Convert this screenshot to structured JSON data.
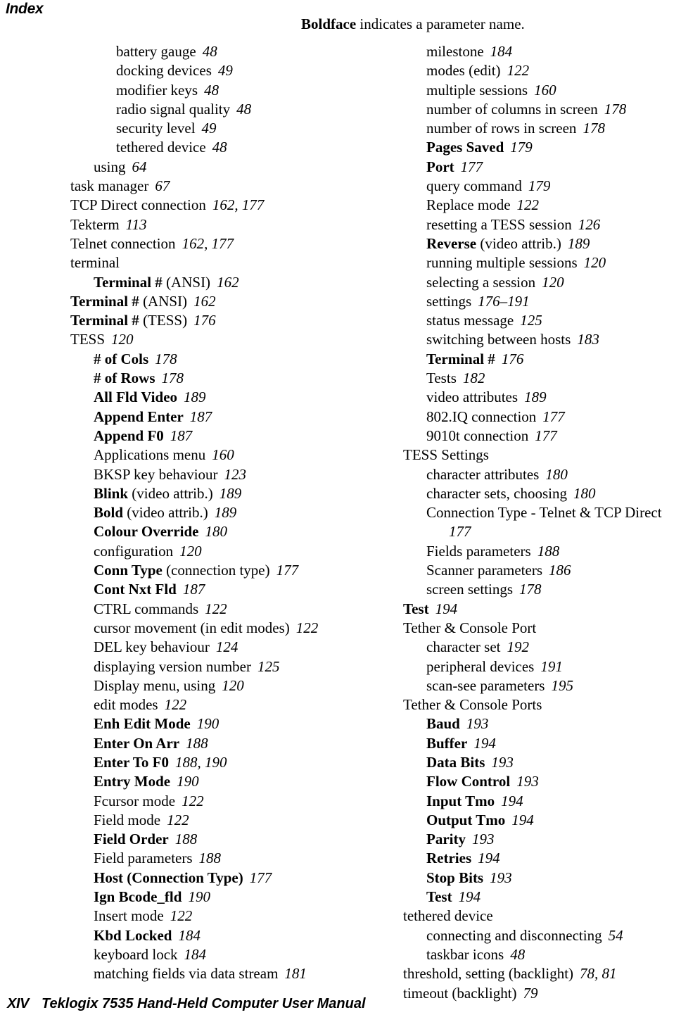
{
  "header": {
    "title": "Index",
    "note_bold": "Boldface",
    "note_rest": " indicates a parameter name."
  },
  "footer": {
    "folio": "XIV",
    "title": "Teklogix 7535 Hand-Held Computer User Manual"
  },
  "columns": {
    "left": [
      {
        "level": 2,
        "text": "battery gauge",
        "bold": false,
        "pages": "48"
      },
      {
        "level": 2,
        "text": "docking devices",
        "bold": false,
        "pages": "49"
      },
      {
        "level": 2,
        "text": "modifier keys",
        "bold": false,
        "pages": "48"
      },
      {
        "level": 2,
        "text": "radio signal quality",
        "bold": false,
        "pages": "48"
      },
      {
        "level": 2,
        "text": "security level",
        "bold": false,
        "pages": "49"
      },
      {
        "level": 2,
        "text": "tethered device",
        "bold": false,
        "pages": "48"
      },
      {
        "level": 1,
        "text": "using",
        "bold": false,
        "pages": "64"
      },
      {
        "level": 0,
        "text": "task manager",
        "bold": false,
        "pages": "67"
      },
      {
        "level": 0,
        "text": "TCP Direct connection",
        "bold": false,
        "pages": "162, 177"
      },
      {
        "level": 0,
        "text": "Tekterm",
        "bold": false,
        "pages": "113"
      },
      {
        "level": 0,
        "text": "Telnet connection",
        "bold": false,
        "pages": "162, 177"
      },
      {
        "level": 0,
        "text": "terminal",
        "bold": false,
        "pages": ""
      },
      {
        "level": 1,
        "text": "Terminal #",
        "bold": true,
        "suffix": " (ANSI)",
        "pages": "162"
      },
      {
        "level": 0,
        "text": "Terminal #",
        "bold": true,
        "suffix": " (ANSI)",
        "pages": "162"
      },
      {
        "level": 0,
        "text": "Terminal #",
        "bold": true,
        "suffix": " (TESS)",
        "pages": "176"
      },
      {
        "level": 0,
        "text": "TESS",
        "bold": false,
        "pages": "120"
      },
      {
        "level": 1,
        "text": "# of Cols",
        "bold": true,
        "pages": "178"
      },
      {
        "level": 1,
        "text": "# of Rows",
        "bold": true,
        "pages": "178"
      },
      {
        "level": 1,
        "text": "All Fld Video",
        "bold": true,
        "pages": "189"
      },
      {
        "level": 1,
        "text": "Append Enter",
        "bold": true,
        "pages": "187"
      },
      {
        "level": 1,
        "text": "Append F0",
        "bold": true,
        "pages": "187"
      },
      {
        "level": 1,
        "text": "Applications menu",
        "bold": false,
        "pages": "160"
      },
      {
        "level": 1,
        "text": "BKSP key behaviour",
        "bold": false,
        "pages": "123"
      },
      {
        "level": 1,
        "text": "Blink",
        "bold": true,
        "suffix": " (video attrib.)",
        "pages": "189"
      },
      {
        "level": 1,
        "text": "Bold",
        "bold": true,
        "suffix": " (video attrib.)",
        "pages": "189"
      },
      {
        "level": 1,
        "text": "Colour Override",
        "bold": true,
        "pages": "180"
      },
      {
        "level": 1,
        "text": "configuration",
        "bold": false,
        "pages": "120"
      },
      {
        "level": 1,
        "text": "Conn Type",
        "bold": true,
        "suffix": " (connection type)",
        "pages": "177"
      },
      {
        "level": 1,
        "text": "Cont Nxt Fld",
        "bold": true,
        "pages": "187"
      },
      {
        "level": 1,
        "text": "CTRL commands",
        "bold": false,
        "pages": "122"
      },
      {
        "level": 1,
        "text": "cursor movement (in edit modes)",
        "bold": false,
        "pages": "122"
      },
      {
        "level": 1,
        "text": "DEL key behaviour",
        "bold": false,
        "pages": "124"
      },
      {
        "level": 1,
        "text": "displaying version number",
        "bold": false,
        "pages": "125"
      },
      {
        "level": 1,
        "text": "Display menu, using",
        "bold": false,
        "pages": "120"
      },
      {
        "level": 1,
        "text": "edit modes",
        "bold": false,
        "pages": "122"
      },
      {
        "level": 1,
        "text": "Enh Edit Mode",
        "bold": true,
        "pages": "190"
      },
      {
        "level": 1,
        "text": "Enter On Arr",
        "bold": true,
        "pages": "188"
      },
      {
        "level": 1,
        "text": "Enter To F0",
        "bold": true,
        "pages": "188, 190"
      },
      {
        "level": 1,
        "text": "Entry Mode",
        "bold": true,
        "pages": "190"
      },
      {
        "level": 1,
        "text": "Fcursor mode",
        "bold": false,
        "pages": "122"
      },
      {
        "level": 1,
        "text": "Field mode",
        "bold": false,
        "pages": "122"
      },
      {
        "level": 1,
        "text": "Field Order",
        "bold": true,
        "pages": "188"
      },
      {
        "level": 1,
        "text": "Field parameters",
        "bold": false,
        "pages": "188"
      },
      {
        "level": 1,
        "text": "Host (Connection Type)",
        "bold": true,
        "pages": "177"
      },
      {
        "level": 1,
        "text": "Ign Bcode_fld",
        "bold": true,
        "pages": "190"
      },
      {
        "level": 1,
        "text": "Insert mode",
        "bold": false,
        "pages": "122"
      },
      {
        "level": 1,
        "text": "Kbd Locked",
        "bold": true,
        "pages": "184"
      },
      {
        "level": 1,
        "text": "keyboard lock",
        "bold": false,
        "pages": "184"
      },
      {
        "level": 1,
        "text": "matching fields via data stream",
        "bold": false,
        "pages": "181"
      }
    ],
    "right": [
      {
        "level": 1,
        "text": "milestone",
        "bold": false,
        "pages": "184"
      },
      {
        "level": 1,
        "text": "modes (edit)",
        "bold": false,
        "pages": "122"
      },
      {
        "level": 1,
        "text": "multiple sessions",
        "bold": false,
        "pages": "160"
      },
      {
        "level": 1,
        "text": "number of columns in screen",
        "bold": false,
        "pages": "178"
      },
      {
        "level": 1,
        "text": "number of rows in screen",
        "bold": false,
        "pages": "178"
      },
      {
        "level": 1,
        "text": "Pages Saved",
        "bold": true,
        "pages": "179"
      },
      {
        "level": 1,
        "text": "Port",
        "bold": true,
        "pages": "177"
      },
      {
        "level": 1,
        "text": "query command",
        "bold": false,
        "pages": "179"
      },
      {
        "level": 1,
        "text": "Replace mode",
        "bold": false,
        "pages": "122"
      },
      {
        "level": 1,
        "text": "resetting a TESS session",
        "bold": false,
        "pages": "126"
      },
      {
        "level": 1,
        "text": "Reverse",
        "bold": true,
        "suffix": " (video attrib.)",
        "pages": "189"
      },
      {
        "level": 1,
        "text": "running multiple sessions",
        "bold": false,
        "pages": "120"
      },
      {
        "level": 1,
        "text": "selecting a session",
        "bold": false,
        "pages": "120"
      },
      {
        "level": 1,
        "text": "settings",
        "bold": false,
        "pages": "176–191"
      },
      {
        "level": 1,
        "text": "status message",
        "bold": false,
        "pages": "125"
      },
      {
        "level": 1,
        "text": "switching between hosts",
        "bold": false,
        "pages": "183"
      },
      {
        "level": 1,
        "text": "Terminal #",
        "bold": true,
        "pages": "176"
      },
      {
        "level": 1,
        "text": "Tests",
        "bold": false,
        "pages": "182"
      },
      {
        "level": 1,
        "text": "video attributes",
        "bold": false,
        "pages": "189"
      },
      {
        "level": 1,
        "text": "802.IQ connection",
        "bold": false,
        "pages": "177"
      },
      {
        "level": 1,
        "text": "9010t connection",
        "bold": false,
        "pages": "177"
      },
      {
        "level": 0,
        "text": "TESS Settings",
        "bold": false,
        "pages": ""
      },
      {
        "level": 1,
        "text": "character attributes",
        "bold": false,
        "pages": "180"
      },
      {
        "level": 1,
        "text": "character sets, choosing",
        "bold": false,
        "pages": "180"
      },
      {
        "level": 1,
        "text": "Connection Type - Telnet & TCP Direct",
        "bold": false,
        "pages": "177",
        "wrapped": true
      },
      {
        "level": 1,
        "text": "Fields parameters",
        "bold": false,
        "pages": "188"
      },
      {
        "level": 1,
        "text": "Scanner parameters",
        "bold": false,
        "pages": "186"
      },
      {
        "level": 1,
        "text": "screen settings",
        "bold": false,
        "pages": "178"
      },
      {
        "level": 0,
        "text": "Test",
        "bold": true,
        "pages": "194"
      },
      {
        "level": 0,
        "text": "Tether & Console Port",
        "bold": false,
        "pages": ""
      },
      {
        "level": 1,
        "text": "character set",
        "bold": false,
        "pages": "192"
      },
      {
        "level": 1,
        "text": "peripheral devices",
        "bold": false,
        "pages": "191"
      },
      {
        "level": 1,
        "text": "scan-see parameters",
        "bold": false,
        "pages": "195"
      },
      {
        "level": 0,
        "text": "Tether & Console Ports",
        "bold": false,
        "pages": ""
      },
      {
        "level": 1,
        "text": "Baud",
        "bold": true,
        "pages": "193"
      },
      {
        "level": 1,
        "text": "Buffer",
        "bold": true,
        "pages": "194"
      },
      {
        "level": 1,
        "text": "Data Bits",
        "bold": true,
        "pages": "193"
      },
      {
        "level": 1,
        "text": "Flow Control",
        "bold": true,
        "pages": "193"
      },
      {
        "level": 1,
        "text": "Input Tmo",
        "bold": true,
        "pages": "194"
      },
      {
        "level": 1,
        "text": "Output Tmo",
        "bold": true,
        "pages": "194"
      },
      {
        "level": 1,
        "text": "Parity",
        "bold": true,
        "pages": "193"
      },
      {
        "level": 1,
        "text": "Retries",
        "bold": true,
        "pages": "194"
      },
      {
        "level": 1,
        "text": "Stop Bits",
        "bold": true,
        "pages": "193"
      },
      {
        "level": 1,
        "text": "Test",
        "bold": true,
        "pages": "194"
      },
      {
        "level": 0,
        "text": "tethered device",
        "bold": false,
        "pages": ""
      },
      {
        "level": 1,
        "text": "connecting and disconnecting",
        "bold": false,
        "pages": "54"
      },
      {
        "level": 1,
        "text": "taskbar icons",
        "bold": false,
        "pages": "48"
      },
      {
        "level": 0,
        "text": "threshold, setting (backlight)",
        "bold": false,
        "pages": "78, 81"
      },
      {
        "level": 0,
        "text": "timeout (backlight)",
        "bold": false,
        "pages": "79"
      }
    ]
  }
}
